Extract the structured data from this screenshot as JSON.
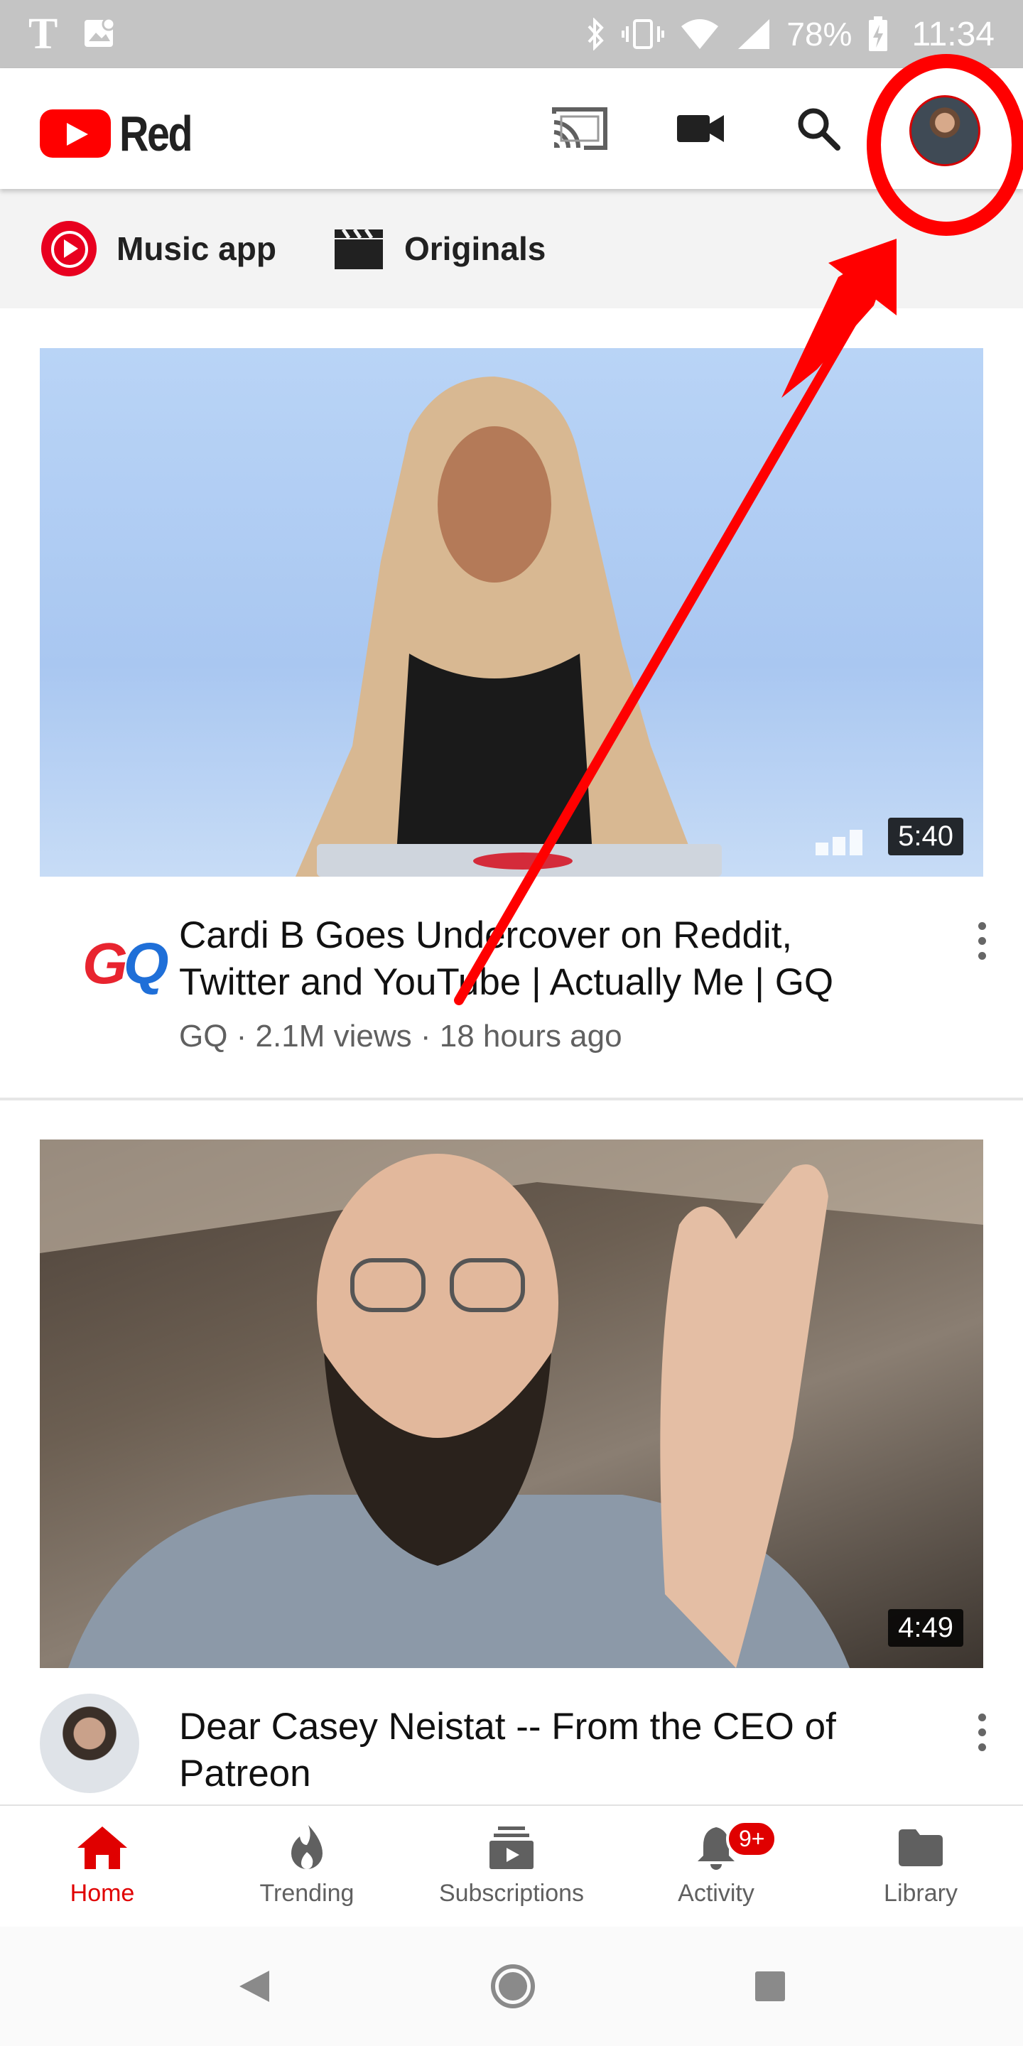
{
  "status_bar": {
    "carrier_icon": "T",
    "battery": "78%",
    "time": "11:34",
    "icons": [
      "t-mobile-icon",
      "gallery-icon",
      "bluetooth-icon",
      "vibrate-icon",
      "wifi-icon",
      "signal-icon",
      "battery-charging-icon"
    ]
  },
  "header": {
    "brand": "Red",
    "icons": [
      "cast-icon",
      "video-camera-icon",
      "search-icon",
      "account-avatar"
    ]
  },
  "chips": [
    {
      "label": "Music app",
      "icon": "music-app-icon"
    },
    {
      "label": "Originals",
      "icon": "clapperboard-icon"
    }
  ],
  "videos": [
    {
      "title_line1": "Cardi B Goes Undercover on Reddit,",
      "title_line2": "Twitter and YouTube | Actually Me | GQ",
      "subtitle": "GQ · 2.1M views · 18 hours ago",
      "duration": "5:40",
      "channel_logo_a": "G",
      "channel_logo_b": "Q"
    },
    {
      "title_line1": "Dear Casey Neistat -- From the CEO of",
      "title_line2": "Patreon",
      "duration": "4:49"
    }
  ],
  "bottom_nav": [
    {
      "label": "Home",
      "icon": "home-icon",
      "active": true
    },
    {
      "label": "Trending",
      "icon": "flame-icon"
    },
    {
      "label": "Subscriptions",
      "icon": "subscriptions-icon"
    },
    {
      "label": "Activity",
      "icon": "bell-icon",
      "badge": "9+"
    },
    {
      "label": "Library",
      "icon": "folder-icon"
    }
  ],
  "colors": {
    "accent": "#ff0000",
    "annotation": "#ff0000",
    "status_bar": "#c4c4c4",
    "chips_bg": "#f3f3f3"
  }
}
